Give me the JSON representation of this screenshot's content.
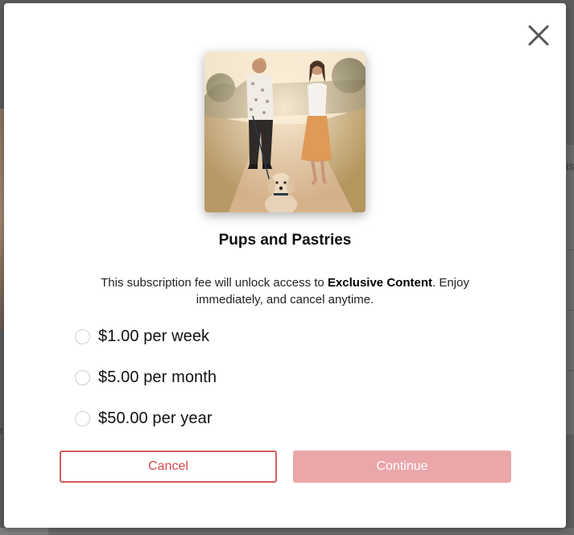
{
  "background": {
    "right_text_fragment": "is",
    "left_text_fragment": "t"
  },
  "modal": {
    "close_icon": "close-icon",
    "photo_alt": "Pups and Pastries",
    "title": "Pups and Pastries",
    "description": {
      "before": "This subscription fee will unlock access to ",
      "bold": "Exclusive Content",
      "after": ". Enjoy immediately, and cancel anytime."
    },
    "options": [
      {
        "label": "$1.00 per week",
        "selected": false
      },
      {
        "label": "$5.00 per month",
        "selected": false
      },
      {
        "label": "$50.00 per year",
        "selected": false
      }
    ],
    "cancel_label": "Cancel",
    "continue_label": "Continue"
  },
  "colors": {
    "accent": "#d4494f",
    "continue_disabled": "#eaa6a9",
    "overlay": "#5d5d5d"
  }
}
